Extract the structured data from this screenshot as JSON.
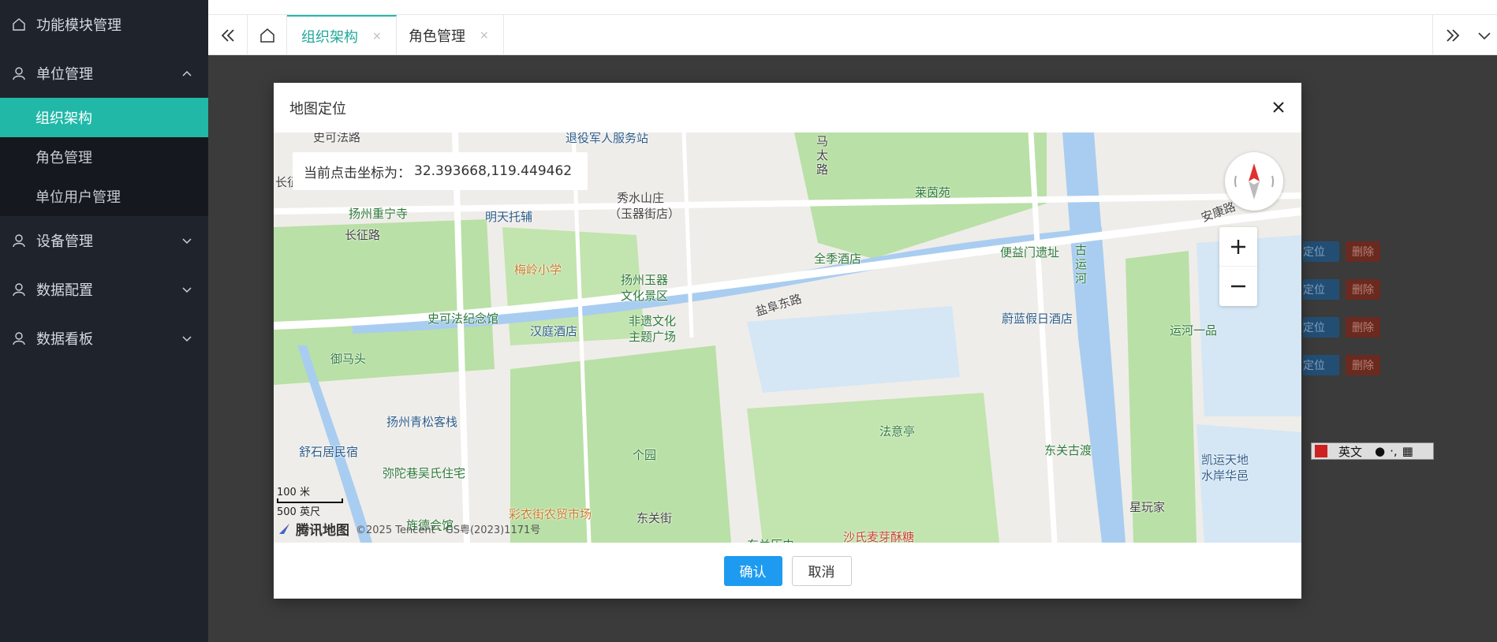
{
  "sidebar": {
    "items": [
      {
        "label": "功能模块管理"
      },
      {
        "label": "单位管理"
      },
      {
        "label": "设备管理"
      },
      {
        "label": "数据配置"
      },
      {
        "label": "数据看板"
      }
    ],
    "sub_items": [
      {
        "label": "组织架构"
      },
      {
        "label": "角色管理"
      },
      {
        "label": "单位用户管理"
      }
    ]
  },
  "tabs": [
    {
      "label": "组织架构",
      "close": "×"
    },
    {
      "label": "角色管理",
      "close": "×"
    }
  ],
  "background_actions": {
    "locate": "定位",
    "delete": "删除"
  },
  "dialog": {
    "title": "地图定位",
    "coord_prefix": "当前点击坐标为：",
    "coord_value": "32.393668,119.449462",
    "confirm": "确认",
    "cancel": "取消"
  },
  "map": {
    "scale_m": "100 米",
    "scale_ft": "500 英尺",
    "brand": "腾讯地图",
    "copyright": "©2025 Tencent - GS粤(2023)1171号",
    "labels": [
      "史可法路",
      "退役军人服务站",
      "秀水山庄",
      "（玉器街店）",
      "扬州重宁寺",
      "明天托辅",
      "长征路",
      "长征",
      "梅岭小学",
      "扬州玉器",
      "文化景区",
      "史可法纪念馆",
      "汉庭酒店",
      "非遗文化",
      "主题广场",
      "御马头",
      "扬州青松客栈",
      "舒石居民宿",
      "弥陀巷吴氏住宅",
      "个园",
      "旌德会馆",
      "彩衣街农贸市场",
      "东关街",
      "马太路",
      "莱茵苑",
      "全季酒店",
      "便益门遗址",
      "盐阜东路",
      "古运河",
      "蔚蓝假日酒店",
      "运河一品",
      "法意亭",
      "东关古渡",
      "凯运天地",
      "水岸华邑",
      "星玩家",
      "沙氏麦芽酥糖",
      "东关历史",
      "安康路"
    ]
  },
  "ime": {
    "mode": "英文"
  }
}
